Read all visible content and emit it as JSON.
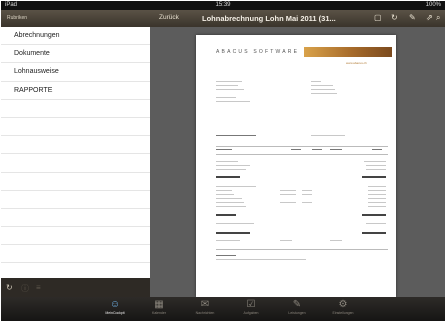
{
  "statusbar": {
    "left": "iPad",
    "time": "15:39",
    "right": "100%"
  },
  "sidebar": {
    "title": "Rubriken",
    "items": [
      {
        "label": "Abrechnungen"
      },
      {
        "label": "Dokumente"
      },
      {
        "label": "Lohnausweise"
      },
      {
        "label": "RAPPORTE"
      }
    ]
  },
  "detail": {
    "back_label": "Zurück",
    "title": "Lohnabrechnung Lohn Mai 2011 (31...",
    "document": {
      "company": "ABACUS SOFTWARE",
      "website": "www.abacus.ch"
    }
  },
  "tabbar": {
    "tabs": [
      {
        "label": "MeinCockpit",
        "icon": "person-icon",
        "active": true
      },
      {
        "label": "Kalender",
        "icon": "calendar-icon",
        "active": false
      },
      {
        "label": "Nachrichten",
        "icon": "envelope-icon",
        "active": false
      },
      {
        "label": "Aufgaben",
        "icon": "checklist-icon",
        "active": false
      },
      {
        "label": "Leistungen",
        "icon": "pencil-icon",
        "active": false
      },
      {
        "label": "Einstellungen",
        "icon": "gear-icon",
        "active": false
      }
    ]
  },
  "colors": {
    "toolbar": "#4a4339",
    "accent": "#6fb2e8",
    "logo": "#c58b3c"
  }
}
